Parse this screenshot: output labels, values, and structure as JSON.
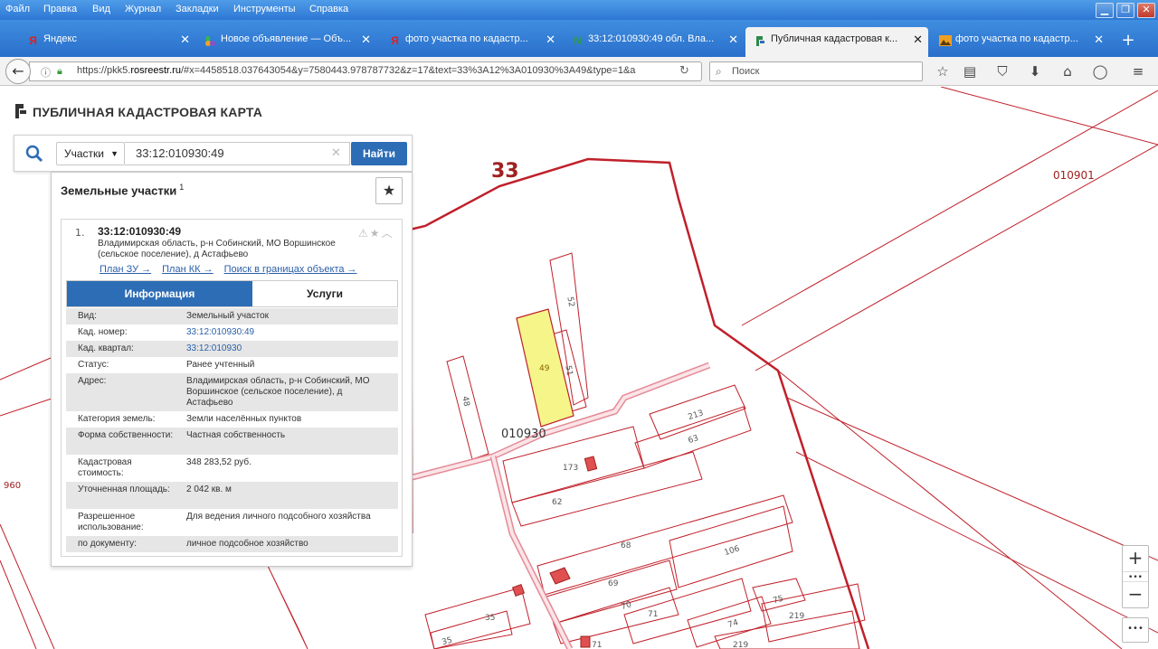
{
  "menubar": {
    "items": [
      "Файл",
      "Правка",
      "Вид",
      "Журнал",
      "Закладки",
      "Инструменты",
      "Справка"
    ]
  },
  "tabs": [
    {
      "label": "Яндекс",
      "icon": "yandex-icon",
      "active": false
    },
    {
      "label": "Новое объявление — Объ...",
      "icon": "avito-icon",
      "active": false
    },
    {
      "label": "фото участка по кадастр...",
      "icon": "yandex-icon",
      "active": false
    },
    {
      "label": "33:12:010930:49 обл. Вла...",
      "icon": "n-icon",
      "active": false
    },
    {
      "label": "Публичная кадастровая к...",
      "icon": "pkk-icon",
      "active": true
    },
    {
      "label": "фото участка по кадастр...",
      "icon": "image-icon",
      "active": false
    }
  ],
  "navbar": {
    "url_prefix": "https://pkk5.",
    "url_domain": "rosreestr.ru",
    "url_rest": "/#x=4458518.037643054&y=7580443.978787732&z=17&text=33%3A12%3A010930%3A49&type=1&a",
    "search_placeholder": "Поиск"
  },
  "app": {
    "title": "ПУБЛИЧНАЯ КАДАСТРОВАЯ КАРТА"
  },
  "search": {
    "type_selected": "Участки",
    "query": "33:12:010930:49",
    "submit_label": "Найти"
  },
  "results": {
    "heading": "Земельные участки",
    "count": "1",
    "item": {
      "index": "1.",
      "cadastral_number": "33:12:010930:49",
      "address": "Владимирская область, р-н Собинский, МО Воршинское (сельское поселение), д Астафьево",
      "links": [
        "План ЗУ →",
        "План КК →",
        "Поиск в границах объекта →"
      ],
      "tabs": {
        "info": "Информация",
        "services": "Услуги"
      },
      "fields": [
        {
          "key": "Вид:",
          "value": "Земельный участок",
          "link": false
        },
        {
          "key": "Кад. номер:",
          "value": "33:12:010930:49",
          "link": true
        },
        {
          "key": "Кад. квартал:",
          "value": "33:12:010930",
          "link": true
        },
        {
          "key": "Статус:",
          "value": "Ранее учтенный",
          "link": false
        },
        {
          "key": "Адрес:",
          "value": "Владимирская область, р-н Собинский, МО Воршинское (сельское поселение), д Астафьево",
          "link": false
        },
        {
          "key": "Категория земель:",
          "value": "Земли населённых пунктов",
          "link": false
        },
        {
          "key": "Форма собственности:",
          "value": "Частная собственность",
          "link": false
        },
        {
          "key": "Кадастровая стоимость:",
          "value": "348 283,52 руб.",
          "link": false
        },
        {
          "key": "Уточненная площадь:",
          "value": "2 042 кв. м",
          "link": false
        },
        {
          "key": "Разрешенное использование:",
          "value": "Для ведения личного подсобного хозяйства",
          "link": false
        },
        {
          "key": "по документу:",
          "value": "личное подсобное хозяйство",
          "link": false
        }
      ]
    }
  },
  "map": {
    "region_label": "33",
    "quarter_labels": [
      "010901",
      "010930",
      "960"
    ],
    "parcel_labels": [
      "49",
      "52",
      "51",
      "48",
      "213",
      "63",
      "173",
      "62",
      "68",
      "106",
      "69",
      "70",
      "71",
      "75",
      "74",
      "219",
      "35",
      "35",
      "219",
      "71"
    ],
    "selected_parcel_color": "#f5f58a",
    "boundary_color": "#c0202a"
  },
  "controls": {
    "zoom_in": "+",
    "zoom_out": "−",
    "more": "•••"
  },
  "colors": {
    "accent": "#2d6db5",
    "titlebar": "#3a84dc"
  }
}
